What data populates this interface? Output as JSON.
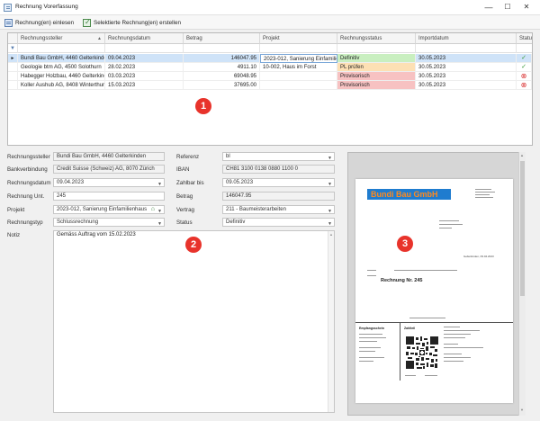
{
  "window": {
    "title": "Rechnung Vorerfassung",
    "minimize": "—",
    "maximize": "☐",
    "close": "✕"
  },
  "toolbar": {
    "import_label": "Rechnung(en) einlesen",
    "create_label": "Selektierte Rechnung(en) erstellen"
  },
  "grid": {
    "columns": [
      "Rechnungssteller",
      "Rechnungsdatum",
      "Betrag",
      "Projekt",
      "Rechnungsstatus",
      "Importdatum",
      "Status"
    ],
    "rows": [
      {
        "steller": "Bundi Bau GmbH, 4460 Gelterkinden",
        "datum": "09.04.2023",
        "betrag": "146047.95",
        "projekt": "2023-012, Sanierung Einfamilienhaus",
        "status_text": "Definitiv",
        "import": "30.05.2023",
        "status_icon": "✓",
        "status_color": "#c9efc0",
        "icon_color": "#3a9a3a"
      },
      {
        "steller": "Geologie btm AG, 4500 Solothurn",
        "datum": "28.02.2023",
        "betrag": "4911.10",
        "projekt": "10-002, Haus im Forst",
        "status_text": "PL prüfen",
        "import": "30.05.2023",
        "status_icon": "✓",
        "status_color": "#fde0b4",
        "icon_color": "#3a9a3a"
      },
      {
        "steller": "Habegger Holzbau, 4460 Gelterkinden",
        "datum": "03.03.2023",
        "betrag": "69048.95",
        "projekt": "",
        "status_text": "Provisorisch",
        "import": "30.05.2023",
        "status_icon": "⊗",
        "status_color": "#f7c2c2",
        "icon_color": "#d93030"
      },
      {
        "steller": "Koller Aushub AG, 8408 Winterthur",
        "datum": "15.03.2023",
        "betrag": "37695.00",
        "projekt": "",
        "status_text": "Provisorisch",
        "import": "30.05.2023",
        "status_icon": "⊗",
        "status_color": "#f7c2c2",
        "icon_color": "#d93030"
      }
    ]
  },
  "form": {
    "rechnungssteller": {
      "label": "Rechnungssteller",
      "value": "Bundi Bau GmbH, 4460 Gelterkinden"
    },
    "bankverbindung": {
      "label": "Bankverbindung",
      "value": "Credit Suisse (Schweiz) AG, 8070 Zürich"
    },
    "rechnungsdatum": {
      "label": "Rechnungsdatum",
      "value": "09.04.2023"
    },
    "rechnung_unt": {
      "label": "Rechnung Unt.",
      "value": "245"
    },
    "projekt": {
      "label": "Projekt",
      "value": "2023-012, Sanierung Einfamilienhaus"
    },
    "rechnungstyp": {
      "label": "Rechnungstyp",
      "value": "Schlussrechnung"
    },
    "notiz": {
      "label": "Notiz",
      "value": "Gemäss Auftrag vom 15.02.2023"
    },
    "referenz": {
      "label": "Referenz",
      "value": "bl"
    },
    "iban": {
      "label": "IBAN",
      "value": "CH81 3100 0138 0880 1100 0"
    },
    "zahlbar_bis": {
      "label": "Zahlbar bis",
      "value": "09.05.2023"
    },
    "betrag": {
      "label": "Betrag",
      "value": "146047.95"
    },
    "vertrag": {
      "label": "Vertrag",
      "value": "211 - Baumeisterarbeiten"
    },
    "status": {
      "label": "Status",
      "value": "Definitiv"
    }
  },
  "preview": {
    "company": "Bundi Bau GmbH",
    "invoice_title": "Rechnung Nr. 245",
    "date_line": "Gelterkinden, 09.04.2023",
    "receipt_title": "Empfangsschein",
    "payment_title": "Zahlteil"
  },
  "markers": [
    "1",
    "2",
    "3"
  ],
  "colors": {
    "selected_row": "#cfe3f8",
    "marker": "#e8332b",
    "company_banner": "#1f7ccf",
    "company_text": "#ff8a1e"
  }
}
